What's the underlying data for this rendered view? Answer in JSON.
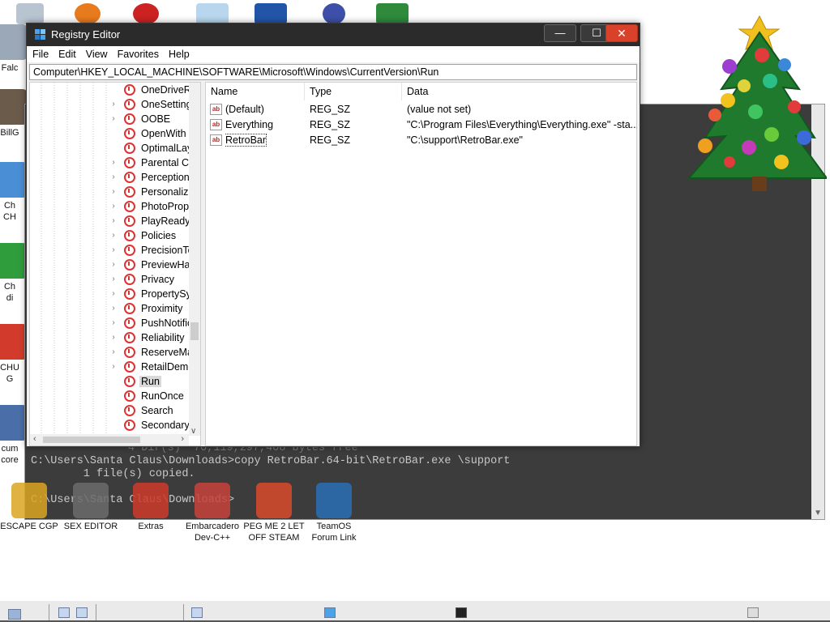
{
  "window": {
    "title": "Registry Editor",
    "minimize_glyph": "—",
    "maximize_glyph": "☐",
    "close_glyph": "✕"
  },
  "menu": [
    "File",
    "Edit",
    "View",
    "Favorites",
    "Help"
  ],
  "address": "Computer\\HKEY_LOCAL_MACHINE\\SOFTWARE\\Microsoft\\Windows\\CurrentVersion\\Run",
  "tree": [
    {
      "label": "OneDriveRa",
      "expandable": false
    },
    {
      "label": "OneSetting",
      "expandable": true
    },
    {
      "label": "OOBE",
      "expandable": true
    },
    {
      "label": "OpenWith",
      "expandable": false
    },
    {
      "label": "OptimalLay",
      "expandable": false
    },
    {
      "label": "Parental Cc",
      "expandable": true
    },
    {
      "label": "Perception",
      "expandable": true
    },
    {
      "label": "Personaliza",
      "expandable": true
    },
    {
      "label": "PhotoPrope",
      "expandable": true
    },
    {
      "label": "PlayReady",
      "expandable": true
    },
    {
      "label": "Policies",
      "expandable": true
    },
    {
      "label": "PrecisionTo",
      "expandable": true
    },
    {
      "label": "PreviewHar",
      "expandable": true
    },
    {
      "label": "Privacy",
      "expandable": true
    },
    {
      "label": "PropertySys",
      "expandable": true
    },
    {
      "label": "Proximity",
      "expandable": true
    },
    {
      "label": "PushNotific",
      "expandable": true
    },
    {
      "label": "Reliability",
      "expandable": true
    },
    {
      "label": "ReserveMar",
      "expandable": true
    },
    {
      "label": "RetailDemc",
      "expandable": true
    },
    {
      "label": "Run",
      "expandable": false,
      "selected": true
    },
    {
      "label": "RunOnce",
      "expandable": false
    },
    {
      "label": "Search",
      "expandable": false
    },
    {
      "label": "SecondaryA",
      "expandable": false
    }
  ],
  "columns": [
    "Name",
    "Type",
    "Data"
  ],
  "values": [
    {
      "name": "(Default)",
      "type": "REG_SZ",
      "data": "(value not set)"
    },
    {
      "name": "Everything",
      "type": "REG_SZ",
      "data": "\"C:\\Program Files\\Everything\\Everything.exe\" -sta..."
    },
    {
      "name": "RetroBar",
      "type": "REG_SZ",
      "data": "\"C:\\support\\RetroBar.exe\"",
      "selected": true
    }
  ],
  "console": {
    "line_partial": "4 Dir(s)  70,119,297,408 bytes free",
    "line_command": "C:\\Users\\Santa Claus\\Downloads>copy RetroBar.64-bit\\RetroBar.exe \\support",
    "line_result": "        1 file(s) copied.",
    "line_prompt": "C:\\Users\\Santa Claus\\Downloads>"
  },
  "desktop_icons_left": [
    {
      "label": "Falc"
    },
    {
      "label": "BillG"
    },
    {
      "label": "Ch\nCH"
    },
    {
      "label": "Ch\ndi"
    },
    {
      "label": "CHU\nG"
    },
    {
      "label": "cum\ncore"
    }
  ],
  "desktop_icons_bottom": [
    {
      "label": "ESCAPE CGP",
      "color": "#d9a520"
    },
    {
      "label": "SEX EDITOR",
      "color": "#6b6b6b"
    },
    {
      "label": "Extras",
      "color": "#cc3a2a"
    },
    {
      "label": "Embarcadero\nDev-C++",
      "color": "#c5423a"
    },
    {
      "label": "PEG ME 2 LET\nOFF STEAM",
      "color": "#d94a2a"
    },
    {
      "label": "TeamOS\nForum Link",
      "color": "#2a6fb5"
    }
  ],
  "colors": {
    "titlebar": "#2b2b2b",
    "close_button": "#d9412a",
    "console_bg": "#3c3c3c",
    "selection": "#d9d9d9"
  }
}
